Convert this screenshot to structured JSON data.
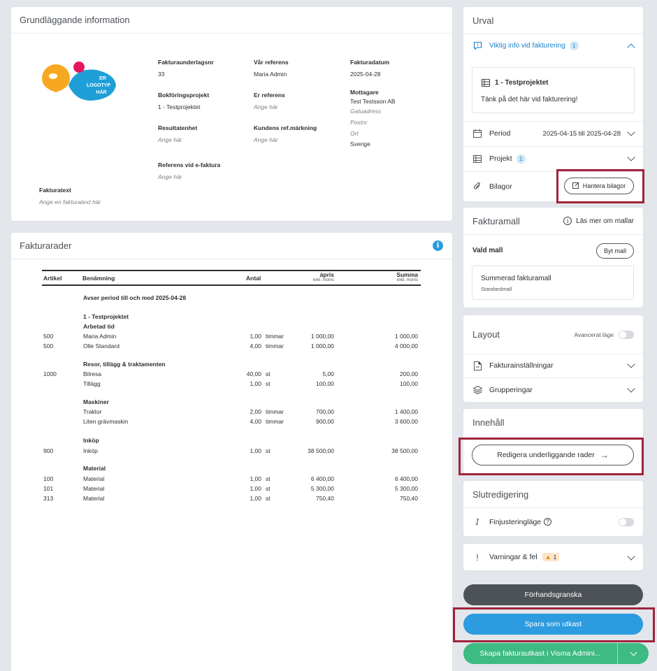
{
  "basic": {
    "title": "Grundläggande information",
    "logo_text": [
      "ER",
      "LOGOTYP",
      "HÄR"
    ],
    "fields": {
      "invoice_basis_no_label": "Fakturaunderlagsnr",
      "invoice_basis_no": "33",
      "our_ref_label": "Vår referens",
      "our_ref": "Maria Admin",
      "invoice_date_label": "Fakturadatum",
      "invoice_date": "2025-04-28",
      "accounting_project_label": "Bokföringsprojekt",
      "accounting_project": "1 - Testprojektet",
      "your_ref_label": "Er referens",
      "your_ref_ph": "Ange här",
      "recipient_label": "Mottagare",
      "recipient_name": "Test Testsson AB",
      "street_ph": "Gatuadress",
      "zip_ph": "Postnr",
      "city_ph": "Ort",
      "country": "Sverige",
      "result_unit_label": "Resultatenhet",
      "result_unit_ph": "Ange här",
      "customer_ref_label": "Kundens ref.märkning",
      "customer_ref_ph": "Ange här",
      "einvoice_ref_label": "Referens vid e-faktura",
      "einvoice_ref_ph": "Ange här",
      "invoice_text_label": "Fakturatext",
      "invoice_text_ph": "Ange en fakturatext här"
    }
  },
  "rows_card": {
    "title": "Fakturarader",
    "headers": {
      "article": "Artikel",
      "name": "Benämning",
      "qty": "Antal",
      "price": "àpris",
      "price_sub": "exkl. moms",
      "sum": "Summa",
      "sum_sub": "exkl. moms"
    },
    "period_text": "Avser period till och med 2025-04-28",
    "project_heading": "1 - Testprojektet",
    "groups": {
      "work": "Arbetad tid",
      "travel": "Resor, tillägg & traktamenten",
      "machines": "Maskiner",
      "purchase": "Inköp",
      "material": "Material"
    },
    "lines": [
      {
        "art": "500",
        "name": "Maria Admin",
        "qty": "1,00",
        "unit": "timmar",
        "price": "1 000,00",
        "sum": "1 000,00"
      },
      {
        "art": "500",
        "name": "Olle Standard",
        "qty": "4,00",
        "unit": "timmar",
        "price": "1 000,00",
        "sum": "4 000,00"
      },
      {
        "art": "1000",
        "name": "Bilresa",
        "qty": "40,00",
        "unit": "st",
        "price": "5,00",
        "sum": "200,00"
      },
      {
        "art": "",
        "name": "Tillägg",
        "qty": "1,00",
        "unit": "st",
        "price": "100,00",
        "sum": "100,00"
      },
      {
        "art": "",
        "name": "Traktor",
        "qty": "2,00",
        "unit": "timmar",
        "price": "700,00",
        "sum": "1 400,00"
      },
      {
        "art": "",
        "name": "Liten grävmaskin",
        "qty": "4,00",
        "unit": "timmar",
        "price": "900,00",
        "sum": "3 600,00"
      },
      {
        "art": "900",
        "name": "Inköp",
        "qty": "1,00",
        "unit": "st",
        "price": "38 500,00",
        "sum": "38 500,00"
      },
      {
        "art": "100",
        "name": "Material",
        "qty": "1,00",
        "unit": "st",
        "price": "6 400,00",
        "sum": "6 400,00"
      },
      {
        "art": "101",
        "name": "Material",
        "qty": "1,00",
        "unit": "st",
        "price": "5 300,00",
        "sum": "5 300,00"
      },
      {
        "art": "313",
        "name": "Material",
        "qty": "1,00",
        "unit": "st",
        "price": "750,40",
        "sum": "750,40"
      }
    ]
  },
  "urval": {
    "title": "Urval",
    "important_info": "Viktig info vid fakturering",
    "important_count": "1",
    "note_project": "1 - Testprojektet",
    "note_text": "Tänk på det här vid fakturering!",
    "period_label": "Period",
    "period_value": "2025-04-15 till 2025-04-28",
    "project_label": "Projekt",
    "project_count": "1",
    "attachments_label": "Bilagor",
    "manage_attachments": "Hantera bilagor"
  },
  "template": {
    "title": "Fakturamall",
    "read_more": "Läs mer om mallar",
    "chosen_label": "Vald mall",
    "change_button": "Byt mall",
    "template_name": "Summerad fakturamall",
    "template_sub": "Standardmall"
  },
  "layout": {
    "title": "Layout",
    "advanced": "Avancerat läge",
    "invoice_settings": "Fakturainställningar",
    "groupings": "Grupperingar"
  },
  "content": {
    "title": "Innehåll",
    "edit_rows": "Redigera underliggande rader"
  },
  "final_edit": {
    "title": "Slutredigering",
    "fine_tune": "Finjusteringläge",
    "warnings": "Varningar & fel",
    "warnings_count": "1"
  },
  "actions": {
    "preview": "Förhandsgranska",
    "save_draft": "Spara som utkast",
    "create_draft": "Skapa fakturautkast i Visma Admini..."
  },
  "colors": {
    "blue": "#2c9be0",
    "dark": "#4d5257",
    "green": "#3dbb82",
    "red_highlight": "#a0243b"
  }
}
